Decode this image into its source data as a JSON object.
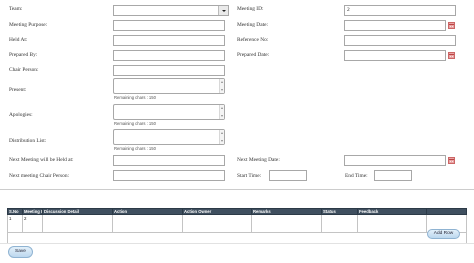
{
  "form": {
    "team_label": "Team:",
    "team_value": "",
    "meeting_id_label": "Meeting ID:",
    "meeting_id_value": "2",
    "meeting_purpose_label": "Meeting Purpose:",
    "meeting_date_label": "Meeting Date:",
    "held_at_label": "Held At:",
    "reference_no_label": "Reference No:",
    "prepared_by_label": "Prepared By:",
    "prepared_date_label": "Prepared Date:",
    "chair_person_label": "Chair Person:",
    "present_label": "Present:",
    "apologies_label": "Apologies:",
    "distribution_list_label": "Distribution List:",
    "remaining_chars": "Remaining chars : 150",
    "next_meeting_held_at_label": "Next Meeting will be Held at:",
    "next_meeting_date_label": "Next Meeting Date:",
    "next_chair_person_label": "Next meeting Chair Person:",
    "start_time_label": "Start Time:",
    "end_time_label": "End Time:"
  },
  "grid": {
    "columns": [
      "S.No",
      "Meeting ID",
      "Discussion Detail",
      "Action",
      "Action Owner",
      "Remarks",
      "Status",
      "Feedback",
      ""
    ],
    "rows": [
      [
        "1",
        "2",
        "",
        "",
        "",
        "",
        "",
        "",
        ""
      ]
    ]
  },
  "buttons": {
    "add_row": "Add Row",
    "save": "Save"
  },
  "colors": {
    "grid_header_bg": "#3f4f5f",
    "button_bg": "#bcd7ee",
    "calendar_icon": "#e9a3a3"
  }
}
